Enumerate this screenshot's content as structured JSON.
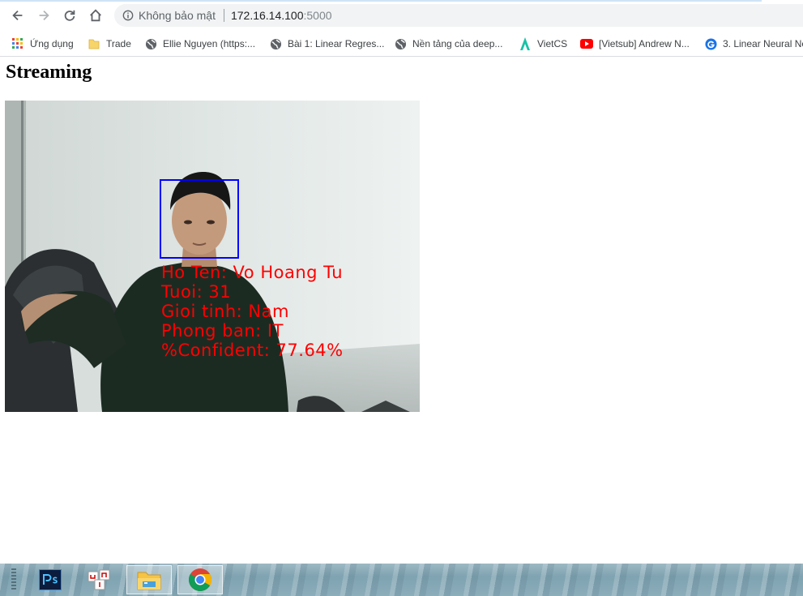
{
  "browser": {
    "security_label": "Không bảo mật",
    "url_host": "172.16.14.100",
    "url_port": ":5000"
  },
  "bookmarks": [
    {
      "label": "Ứng dụng",
      "icon": "apps-grid-icon"
    },
    {
      "label": "Trade",
      "icon": "folder-icon"
    },
    {
      "label": "Ellie Nguyen (https:...",
      "icon": "globe-icon"
    },
    {
      "label": "Bài 1: Linear Regres...",
      "icon": "globe-icon"
    },
    {
      "label": "Nền tảng của deep...",
      "icon": "globe-icon"
    },
    {
      "label": "VietCS",
      "icon": "vietcs-icon"
    },
    {
      "label": "[Vietsub] Andrew N...",
      "icon": "youtube-icon"
    },
    {
      "label": "3. Linear Neural Ne",
      "icon": "g-logo-icon"
    }
  ],
  "page": {
    "title": "Streaming"
  },
  "stream": {
    "overlay": {
      "name": "Ho Ten: Vo Hoang Tu",
      "age": "Tuoi: 31",
      "gender": "Gioi tinh: Nam",
      "department": "Phong ban: IT",
      "confidence": "%Confident: 77.64%"
    },
    "overlay_color": "#ff0000",
    "face_box_color": "#0000ff"
  },
  "taskbar": {
    "apps": [
      "photoshop-icon",
      "unikey-icon",
      "file-explorer-icon",
      "chrome-icon"
    ],
    "active_app": "chrome-icon"
  }
}
